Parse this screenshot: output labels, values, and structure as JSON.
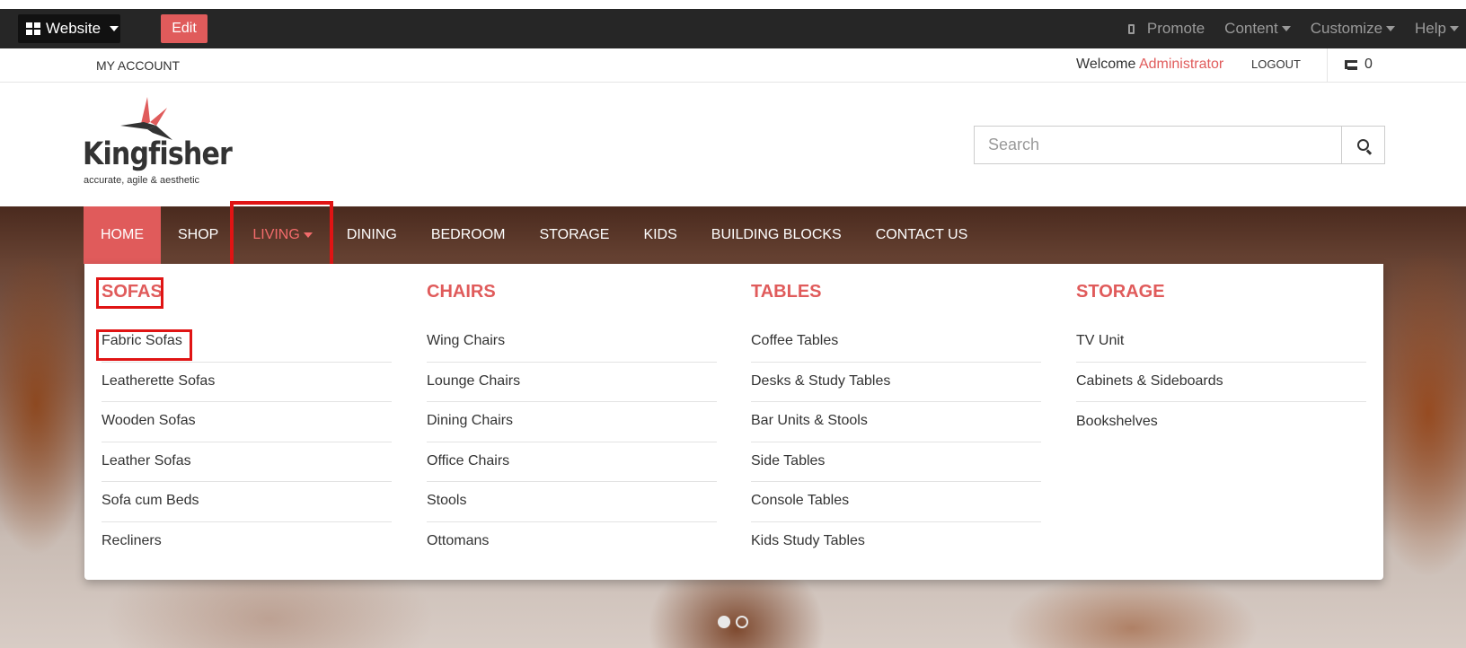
{
  "adminbar": {
    "website_label": "Website",
    "edit_label": "Edit",
    "promote_label": "Promote",
    "content_label": "Content",
    "customize_label": "Customize",
    "help_label": "Help"
  },
  "accountbar": {
    "my_account_label": "MY ACCOUNT",
    "welcome_prefix": "Welcome",
    "user_name": "Administrator",
    "logout_label": "LOGOUT",
    "cart_count": "0"
  },
  "header": {
    "logo_text": "Kingfisher",
    "logo_tagline": "accurate, agile & aesthetic",
    "search_placeholder": "Search"
  },
  "nav": {
    "items": [
      "HOME",
      "SHOP",
      "LIVING",
      "DINING",
      "BEDROOM",
      "STORAGE",
      "KIDS",
      "BUILDING BLOCKS",
      "CONTACT US"
    ],
    "active": "HOME",
    "open": "LIVING"
  },
  "megamenu": {
    "columns": [
      {
        "heading": "SOFAS",
        "items": [
          "Fabric Sofas",
          "Leatherette Sofas",
          "Wooden Sofas",
          "Leather Sofas",
          "Sofa cum Beds",
          "Recliners"
        ]
      },
      {
        "heading": "CHAIRS",
        "items": [
          "Wing Chairs",
          "Lounge Chairs",
          "Dining Chairs",
          "Office Chairs",
          "Stools",
          "Ottomans"
        ]
      },
      {
        "heading": "TABLES",
        "items": [
          "Coffee Tables",
          "Desks & Study Tables",
          "Bar Units & Stools",
          "Side Tables",
          "Console Tables",
          "Kids Study Tables"
        ]
      },
      {
        "heading": "STORAGE",
        "items": [
          "TV Unit",
          "Cabinets & Sideboards",
          "Bookshelves"
        ]
      }
    ]
  },
  "carousel": {
    "slides": 2,
    "active_index": 0
  },
  "colors": {
    "accent": "#e05b5b",
    "highlight_box": "#e01414",
    "adminbar_bg": "#262626"
  }
}
